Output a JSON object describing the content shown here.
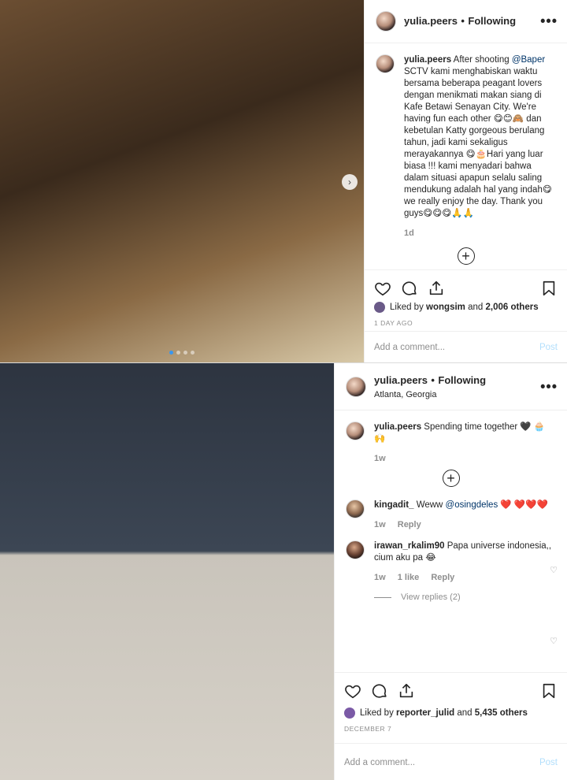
{
  "post1": {
    "username": "yulia.peers",
    "dot": "•",
    "follow": "Following",
    "caption_user": "yulia.peers",
    "caption_parts": {
      "pre": "After shooting ",
      "mention": "@Baper",
      "post": " SCTV kami menghabiskan waktu bersama beberapa peagant lovers dengan menikmati makan siang di Kafe Betawi Senayan City. We're having fun each other 😋😊🙈 dan kebetulan Katty gorgeous berulang tahun, jadi kami sekaligus merayakannya 😋🎂Hari yang luar biasa !!! kami menyadari bahwa dalam situasi apapun selalu saling mendukung adalah hal yang indah😋 we really enjoy the day. Thank you guys😋😋😋🙏🙏"
    },
    "time": "1d",
    "liked_by_prefix": "Liked by ",
    "liked_by_user": "wongsim",
    "liked_by_and": " and ",
    "liked_by_count": "2,006 others",
    "date": "1 DAY AGO",
    "add_comment_placeholder": "Add a comment...",
    "post_label": "Post"
  },
  "post2": {
    "username": "yulia.peers",
    "dot": "•",
    "follow": "Following",
    "location": "Atlanta, Georgia",
    "caption_user": "yulia.peers",
    "caption_text": "Spending time together 🖤 🧁🙌",
    "caption_time": "1w",
    "comments": [
      {
        "user": "kingadit_",
        "text_pre": "Weww ",
        "mention": "@osingdeles",
        "text_post": " ❤️ ❤️❤️❤️",
        "time": "1w",
        "like": "",
        "reply": "Reply"
      },
      {
        "user": "irawan_rkalim90",
        "text_pre": "Papa universe indonesia,, cium aku pa 😂",
        "mention": "",
        "text_post": "",
        "time": "1w",
        "like": "1 like",
        "reply": "Reply"
      }
    ],
    "view_replies": "View replies (2)",
    "liked_by_prefix": "Liked by ",
    "liked_by_user": "reporter_julid",
    "liked_by_and": " and ",
    "liked_by_count": "5,435 others",
    "date": "DECEMBER 7",
    "add_comment_placeholder": "Add a comment...",
    "post_label": "Post"
  },
  "icons": {
    "like": "heart-icon",
    "comment": "comment-icon",
    "share": "share-icon",
    "save": "bookmark-icon",
    "more": "more-options-icon",
    "add": "plus-circle-icon"
  },
  "colors": {
    "text": "#262626",
    "muted": "#8e8e8e",
    "link": "#003569",
    "post_disabled": "#b2dffc",
    "border": "#efefef"
  }
}
